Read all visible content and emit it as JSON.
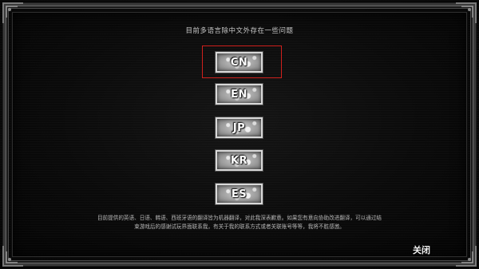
{
  "notice_text": "目前多语言除中文外存在一些问题",
  "language_buttons": [
    {
      "label": "CN",
      "selected": true
    },
    {
      "label": "EN",
      "selected": false
    },
    {
      "label": "JP",
      "selected": false
    },
    {
      "label": "KR",
      "selected": false
    },
    {
      "label": "ES",
      "selected": false
    }
  ],
  "disclaimer": {
    "line1": "目前提供的英语、日语、韩语、西班牙语的翻译皆为机器翻译，对此我深表歉意。如果您有意向协助改进翻译，可以通过结",
    "line2": "束游戏后的感谢试玩界面联系我，有关于我的联系方式或者关联账号等等，我将不胜感激。"
  },
  "close_label": "关闭",
  "colors": {
    "selection_outline": "#d0201c",
    "background": "#060606",
    "button_face": "#b5b5b5"
  }
}
